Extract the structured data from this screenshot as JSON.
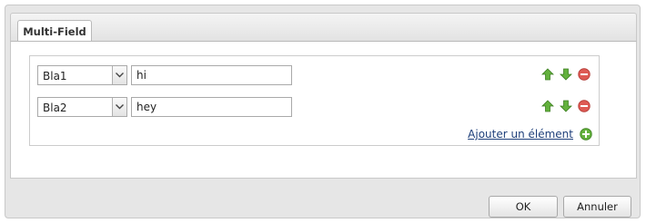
{
  "tab": {
    "label": "Multi-Field"
  },
  "rows": [
    {
      "select_value": "Bla1",
      "text_value": "hi"
    },
    {
      "select_value": "Bla2",
      "text_value": "hey"
    }
  ],
  "add": {
    "label": "Ajouter un élément",
    "icon": "add-circle-icon"
  },
  "icons": {
    "up": "arrow-up-icon",
    "down": "arrow-down-icon",
    "remove": "remove-circle-icon"
  },
  "colors": {
    "link": "#1e3f7a",
    "icon_green": "#5fa83a",
    "icon_red": "#d9534f"
  },
  "buttons": {
    "ok": "OK",
    "cancel": "Annuler"
  }
}
